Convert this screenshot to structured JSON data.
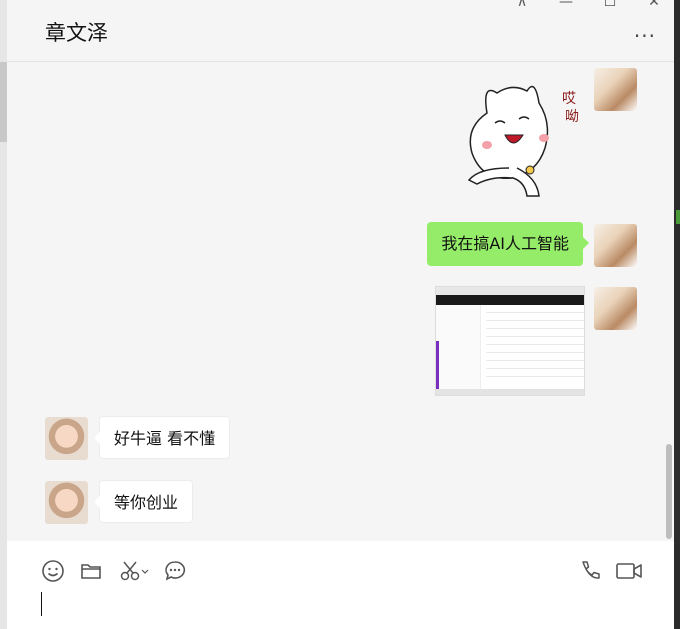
{
  "header": {
    "title": "章文泽",
    "more_label": "···",
    "window_controls": {
      "pin": "⊼",
      "minimize": "—",
      "maximize": "☐",
      "close": "✕"
    }
  },
  "messages": [
    {
      "id": 1,
      "direction": "outgoing",
      "type": "sticker",
      "sticker_text": [
        "哎",
        "呦"
      ]
    },
    {
      "id": 2,
      "direction": "outgoing",
      "type": "text",
      "text": "我在搞AI人工智能"
    },
    {
      "id": 3,
      "direction": "outgoing",
      "type": "image"
    },
    {
      "id": 4,
      "direction": "incoming",
      "type": "text",
      "text": "好牛逼 看不懂"
    },
    {
      "id": 5,
      "direction": "incoming",
      "type": "text",
      "text": "等你创业"
    }
  ],
  "toolbar": {
    "icons": [
      "emoji-icon",
      "folder-icon",
      "scissors-icon",
      "chat-history-icon",
      "phone-icon",
      "video-icon"
    ]
  },
  "colors": {
    "outgoing_bubble": "#95ec69",
    "incoming_bubble": "#ffffff",
    "background": "#f5f5f5"
  }
}
